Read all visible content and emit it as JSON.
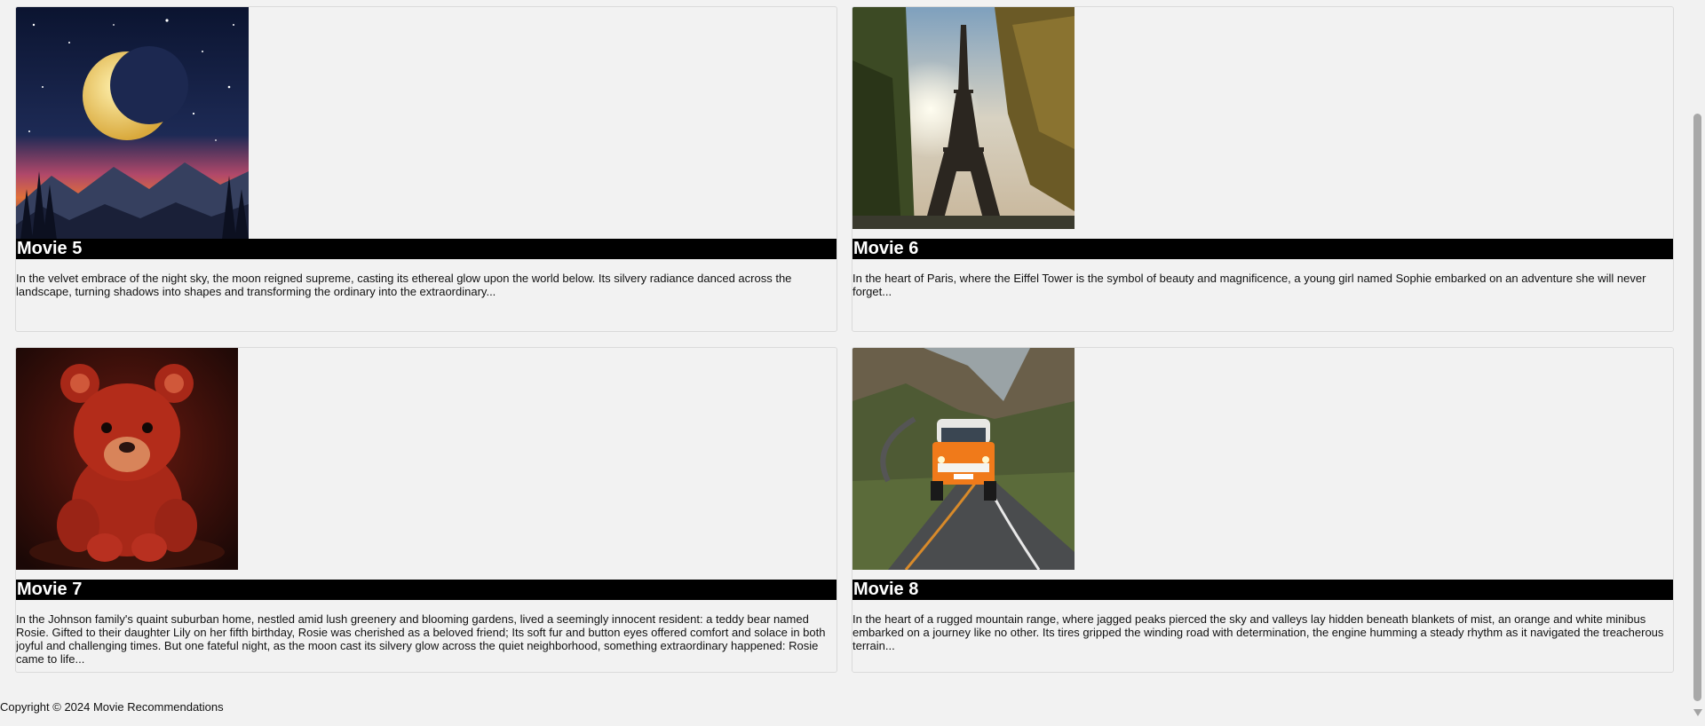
{
  "movies": [
    {
      "title": "Movie 5",
      "description": "In the velvet embrace of the night sky, the moon reigned supreme, casting its ethereal glow upon the world below. Its silvery radiance danced across the landscape, turning shadows into shapes and transforming the ordinary into the extraordinary...",
      "image": "crescent-moon-night-sky"
    },
    {
      "title": "Movie 6",
      "description": "In the heart of Paris, where the Eiffel Tower is the symbol of beauty and magnificence, a young girl named Sophie embarked on an adventure she will never forget...",
      "image": "eiffel-tower-sunlight"
    },
    {
      "title": "Movie 7",
      "description": "In the Johnson family's quaint suburban home, nestled amid lush greenery and blooming gardens, lived a seemingly innocent resident: a teddy bear named Rosie. Gifted to their daughter Lily on her fifth birthday, Rosie was cherished as a beloved friend; Its soft fur and button eyes offered comfort and solace in both joyful and challenging times. But one fateful night, as the moon cast its silvery glow across the quiet neighborhood, something extraordinary happened: Rosie came to life...",
      "image": "red-teddy-bear"
    },
    {
      "title": "Movie 8",
      "description": "In the heart of a rugged mountain range, where jagged peaks pierced the sky and valleys lay hidden beneath blankets of mist, an orange and white minibus embarked on a journey like no other. Its tires gripped the winding road with determination, the engine humming a steady rhythm as it navigated the treacherous terrain...",
      "image": "orange-minibus-mountain-road"
    }
  ],
  "footer": {
    "copyright": "Copyright © 2024 Movie Recommendations"
  },
  "colors": {
    "background": "#f2f2f2",
    "title_bar": "#000000",
    "title_text": "#ffffff"
  }
}
